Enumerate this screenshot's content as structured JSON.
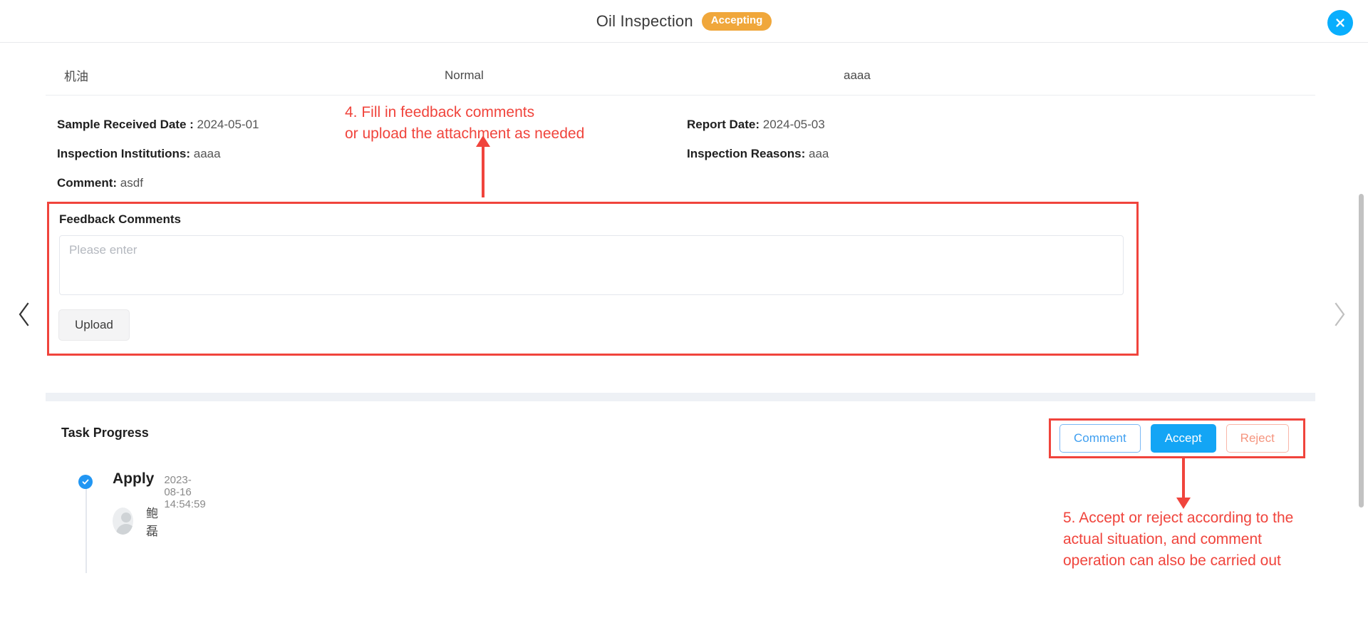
{
  "header": {
    "title": "Oil Inspection",
    "status_badge": "Accepting",
    "close_icon": "close-icon"
  },
  "nav": {
    "prev_icon": "chevron-left-icon",
    "next_icon": "chevron-right-icon"
  },
  "row_table": {
    "rows": [
      {
        "name": "机油",
        "result": "Normal",
        "note": "aaaa"
      }
    ]
  },
  "details": {
    "left": [
      {
        "label": "Sample Received Date :",
        "value": "2024-05-01"
      },
      {
        "label": "Inspection Institutions:",
        "value": "aaaa"
      },
      {
        "label": "Comment:",
        "value": "asdf"
      }
    ],
    "right": [
      {
        "label": "Report Date:",
        "value": "2024-05-03"
      },
      {
        "label": "Inspection Reasons:",
        "value": "aaa"
      }
    ]
  },
  "annotations": {
    "step4": "4. Fill in feedback comments\nor upload the attachment as needed",
    "step5": "5. Accept or reject according to the\nactual situation, and comment\noperation can also be carried out",
    "color": "#f0443c"
  },
  "feedback": {
    "title": "Feedback Comments",
    "placeholder": "Please enter",
    "value": "",
    "upload_label": "Upload"
  },
  "task_progress": {
    "title": "Task Progress",
    "entries": [
      {
        "name": "Apply",
        "time": "2023-08-16 14:54:59",
        "user": "鲍磊",
        "status_icon": "check-circle-icon"
      }
    ]
  },
  "actions": {
    "comment_label": "Comment",
    "accept_label": "Accept",
    "reject_label": "Reject",
    "accent_color": "#13a5f5",
    "reject_color": "#f5957f"
  }
}
